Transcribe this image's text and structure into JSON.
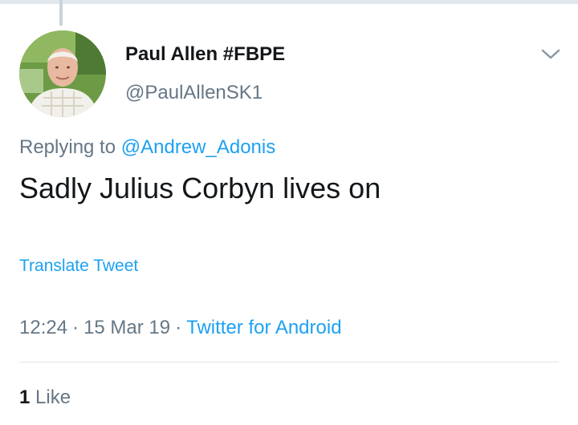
{
  "tweet": {
    "display_name": "Paul Allen #FBPE",
    "handle": "@PaulAllenSK1",
    "replying_prefix": "Replying to",
    "replying_to": "@Andrew_Adonis",
    "text": "Sadly Julius Corbyn lives on",
    "translate_label": "Translate Tweet",
    "time": "12:24",
    "date": "15 Mar 19",
    "source": "Twitter for Android",
    "like_count": "1",
    "like_label": "Like"
  },
  "colors": {
    "link": "#1da1f2",
    "secondary_text": "#657786",
    "primary_text": "#14171a"
  },
  "icons": {
    "menu": "chevron-down-icon",
    "avatar": "profile-photo"
  }
}
